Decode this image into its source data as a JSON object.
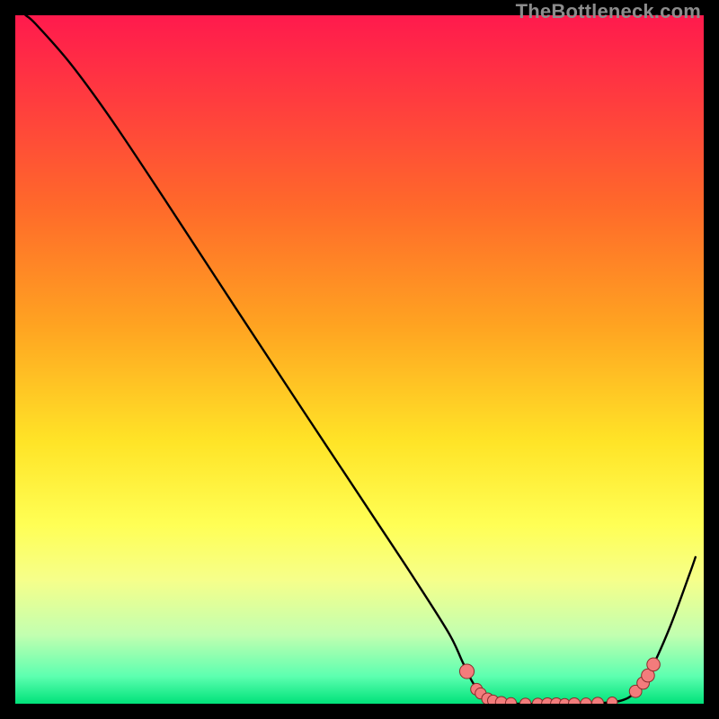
{
  "watermark": "TheBottleneck.com",
  "colors": {
    "frame": "#000000",
    "gradient_stops": [
      {
        "offset": 0.0,
        "color": "#ff1a4d"
      },
      {
        "offset": 0.12,
        "color": "#ff3b3f"
      },
      {
        "offset": 0.28,
        "color": "#ff6a2a"
      },
      {
        "offset": 0.45,
        "color": "#ffa321"
      },
      {
        "offset": 0.62,
        "color": "#ffe427"
      },
      {
        "offset": 0.74,
        "color": "#ffff55"
      },
      {
        "offset": 0.82,
        "color": "#f6ff8a"
      },
      {
        "offset": 0.9,
        "color": "#c2ffb0"
      },
      {
        "offset": 0.96,
        "color": "#5dffb0"
      },
      {
        "offset": 1.0,
        "color": "#00e27a"
      }
    ],
    "curve": "#000000",
    "dot_fill": "#f37c7c",
    "dot_stroke": "#8a2c2c"
  },
  "chart_data": {
    "type": "line",
    "title": "",
    "xlabel": "",
    "ylabel": "",
    "xlim": [
      0,
      100
    ],
    "ylim": [
      0,
      100
    ],
    "curve": [
      {
        "x": 1.5,
        "y": 100.0
      },
      {
        "x": 3.0,
        "y": 98.7
      },
      {
        "x": 8.0,
        "y": 93.0
      },
      {
        "x": 14.0,
        "y": 84.8
      },
      {
        "x": 22.0,
        "y": 72.8
      },
      {
        "x": 32.0,
        "y": 57.5
      },
      {
        "x": 42.0,
        "y": 42.3
      },
      {
        "x": 52.0,
        "y": 27.2
      },
      {
        "x": 58.0,
        "y": 18.1
      },
      {
        "x": 63.0,
        "y": 10.2
      },
      {
        "x": 65.0,
        "y": 6.0
      },
      {
        "x": 66.5,
        "y": 3.0
      },
      {
        "x": 68.0,
        "y": 1.2
      },
      {
        "x": 70.0,
        "y": 0.25
      },
      {
        "x": 73.0,
        "y": 0.0
      },
      {
        "x": 80.0,
        "y": 0.0
      },
      {
        "x": 85.0,
        "y": 0.1
      },
      {
        "x": 88.0,
        "y": 0.45
      },
      {
        "x": 90.0,
        "y": 1.6
      },
      {
        "x": 92.0,
        "y": 4.3
      },
      {
        "x": 95.0,
        "y": 10.9
      },
      {
        "x": 98.0,
        "y": 19.0
      },
      {
        "x": 98.8,
        "y": 21.3
      }
    ],
    "dots": [
      {
        "x": 65.6,
        "y": 4.7,
        "r": 1.05
      },
      {
        "x": 67.0,
        "y": 2.1,
        "r": 0.85
      },
      {
        "x": 67.6,
        "y": 1.5,
        "r": 0.8
      },
      {
        "x": 68.6,
        "y": 0.72,
        "r": 0.85
      },
      {
        "x": 69.4,
        "y": 0.45,
        "r": 0.8
      },
      {
        "x": 70.6,
        "y": 0.2,
        "r": 0.85
      },
      {
        "x": 72.0,
        "y": 0.08,
        "r": 0.8
      },
      {
        "x": 74.1,
        "y": 0.0,
        "r": 0.8
      },
      {
        "x": 75.9,
        "y": 0.0,
        "r": 0.8
      },
      {
        "x": 77.3,
        "y": 0.0,
        "r": 0.85
      },
      {
        "x": 78.6,
        "y": 0.0,
        "r": 0.85
      },
      {
        "x": 79.8,
        "y": 0.0,
        "r": 0.75
      },
      {
        "x": 81.2,
        "y": 0.0,
        "r": 0.85
      },
      {
        "x": 82.9,
        "y": 0.03,
        "r": 0.8
      },
      {
        "x": 84.6,
        "y": 0.08,
        "r": 0.85
      },
      {
        "x": 86.7,
        "y": 0.22,
        "r": 0.75
      },
      {
        "x": 90.1,
        "y": 1.8,
        "r": 0.9
      },
      {
        "x": 91.2,
        "y": 3.0,
        "r": 0.9
      },
      {
        "x": 91.9,
        "y": 4.1,
        "r": 0.95
      },
      {
        "x": 92.7,
        "y": 5.7,
        "r": 0.95
      }
    ]
  }
}
